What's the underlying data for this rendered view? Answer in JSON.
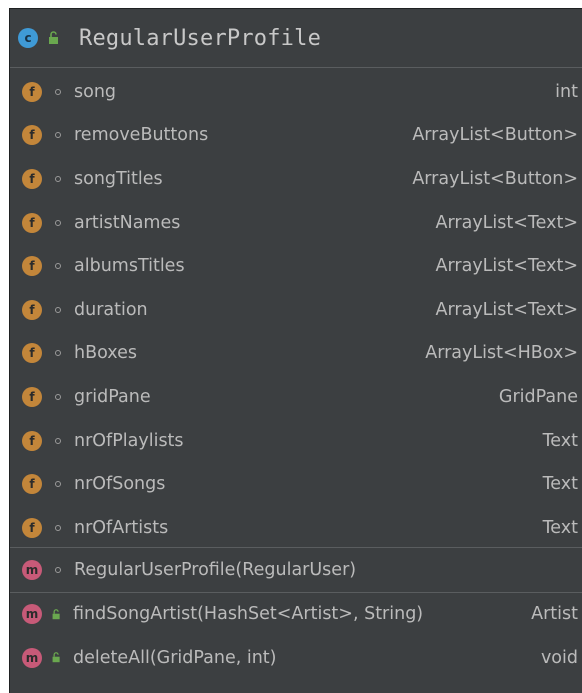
{
  "class": {
    "badge": "c",
    "name": "RegularUserProfile"
  },
  "fields": [
    {
      "badge": "f",
      "name": "song",
      "type": "int"
    },
    {
      "badge": "f",
      "name": "removeButtons",
      "type": "ArrayList<Button>"
    },
    {
      "badge": "f",
      "name": "songTitles",
      "type": "ArrayList<Button>"
    },
    {
      "badge": "f",
      "name": "artistNames",
      "type": "ArrayList<Text>"
    },
    {
      "badge": "f",
      "name": "albumsTitles",
      "type": "ArrayList<Text>"
    },
    {
      "badge": "f",
      "name": "duration",
      "type": "ArrayList<Text>"
    },
    {
      "badge": "f",
      "name": "hBoxes",
      "type": "ArrayList<HBox>"
    },
    {
      "badge": "f",
      "name": "gridPane",
      "type": "GridPane"
    },
    {
      "badge": "f",
      "name": "nrOfPlaylists",
      "type": "Text"
    },
    {
      "badge": "f",
      "name": "nrOfSongs",
      "type": "Text"
    },
    {
      "badge": "f",
      "name": "nrOfArtists",
      "type": "Text"
    }
  ],
  "constructors": [
    {
      "badge": "m",
      "name": "RegularUserProfile(RegularUser)",
      "type": ""
    }
  ],
  "methods": [
    {
      "badge": "m",
      "name": "findSongArtist(HashSet<Artist>, String)",
      "type": "Artist"
    },
    {
      "badge": "m",
      "name": "deleteAll(GridPane, int)",
      "type": "void"
    }
  ],
  "colors": {
    "background": "#3c3f41",
    "class_badge": "#3f9ad6",
    "field_badge": "#c3863a",
    "method_badge": "#c75a78",
    "public_lock": "#6aa84f"
  },
  "icons": {
    "class": "class-icon",
    "field": "field-icon",
    "method": "method-icon",
    "public": "public-lock-icon",
    "package_private": "package-private-icon"
  }
}
